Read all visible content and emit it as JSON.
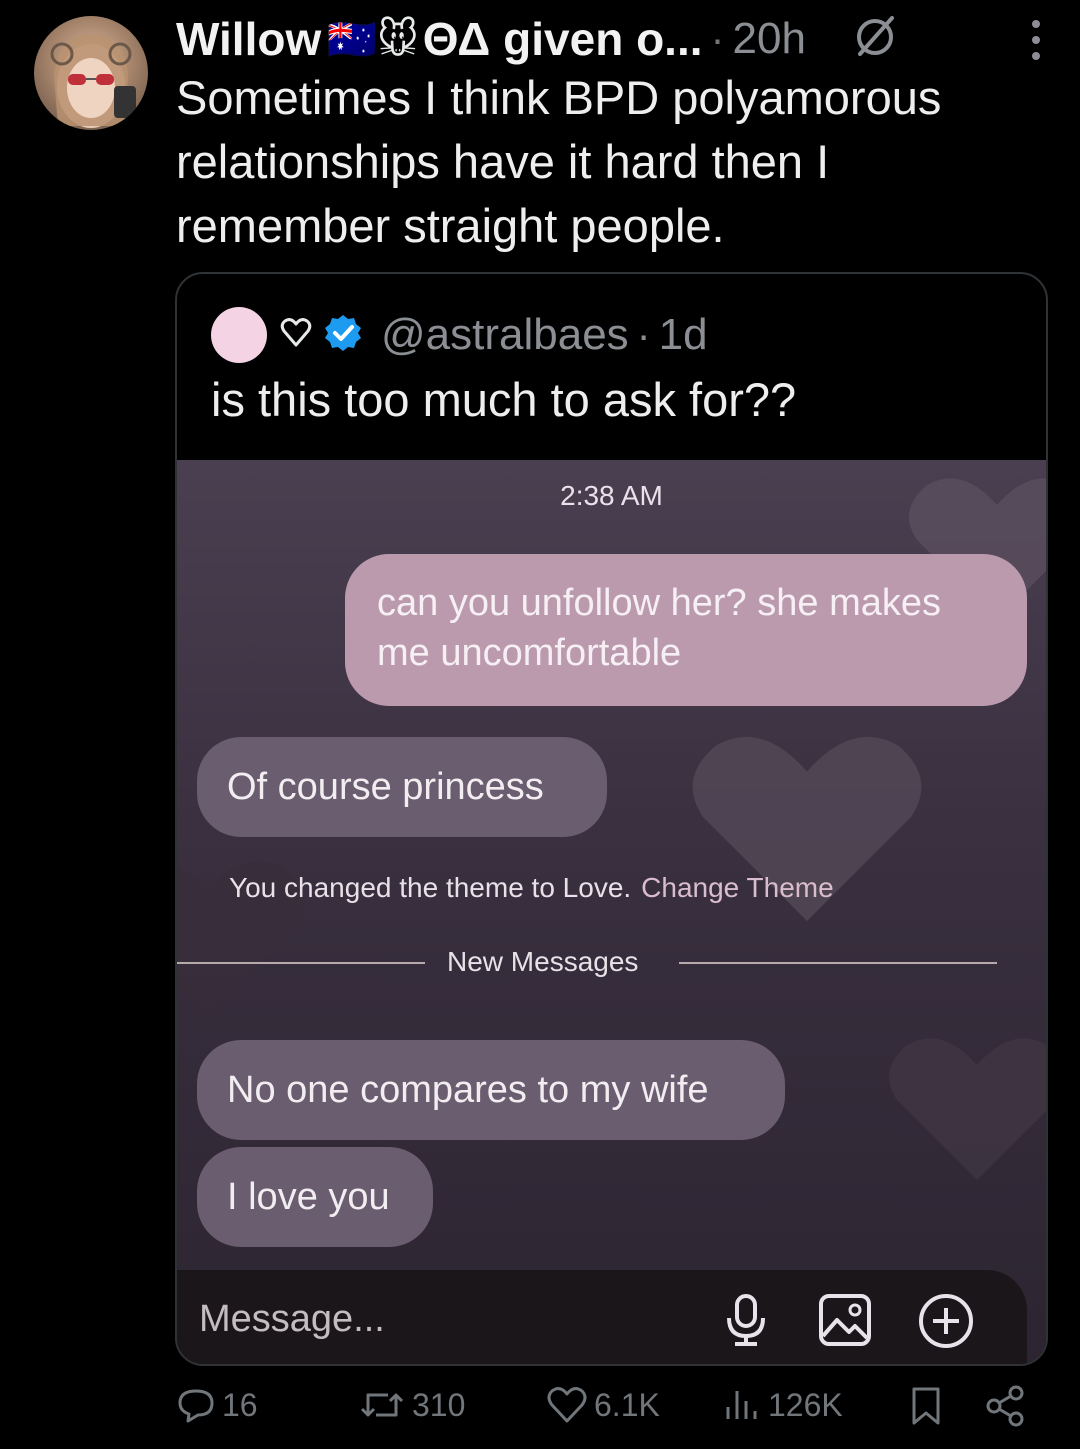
{
  "tweet": {
    "display_name": "Willow",
    "name_emojis": "🇦🇺🐭",
    "name_rest": "ΘΔ given o...",
    "time": "20h",
    "text": "Sometimes I think BPD polyamorous relationships have it hard then I remember straight people."
  },
  "quoted": {
    "handle": "@astralbaes",
    "time": "1d",
    "text": "is this too much to ask for??",
    "chat": {
      "timestamp": "2:38 AM",
      "outgoing_message": "can you unfollow her? she makes me uncomfortable",
      "incoming_1": "Of course princess",
      "system_text": "You changed the theme to Love.",
      "system_link": "Change Theme",
      "divider_label": "New Messages",
      "incoming_2": "No one compares to my wife",
      "incoming_3": "I love you",
      "input_placeholder": "Message..."
    }
  },
  "actions": {
    "replies": "16",
    "reposts": "310",
    "likes": "6.1K",
    "views": "126K"
  },
  "icons": [
    "grok-icon",
    "more-icon",
    "heart-outline-icon",
    "verified-badge-icon",
    "microphone-icon",
    "image-icon",
    "plus-circle-icon",
    "reply-icon",
    "repost-icon",
    "like-icon",
    "views-icon",
    "bookmark-icon",
    "share-icon"
  ],
  "colors": {
    "verified": "#1d9bf0",
    "outgoing_bubble": "#bb9aae",
    "incoming_bubble": "#6a5d6f"
  }
}
